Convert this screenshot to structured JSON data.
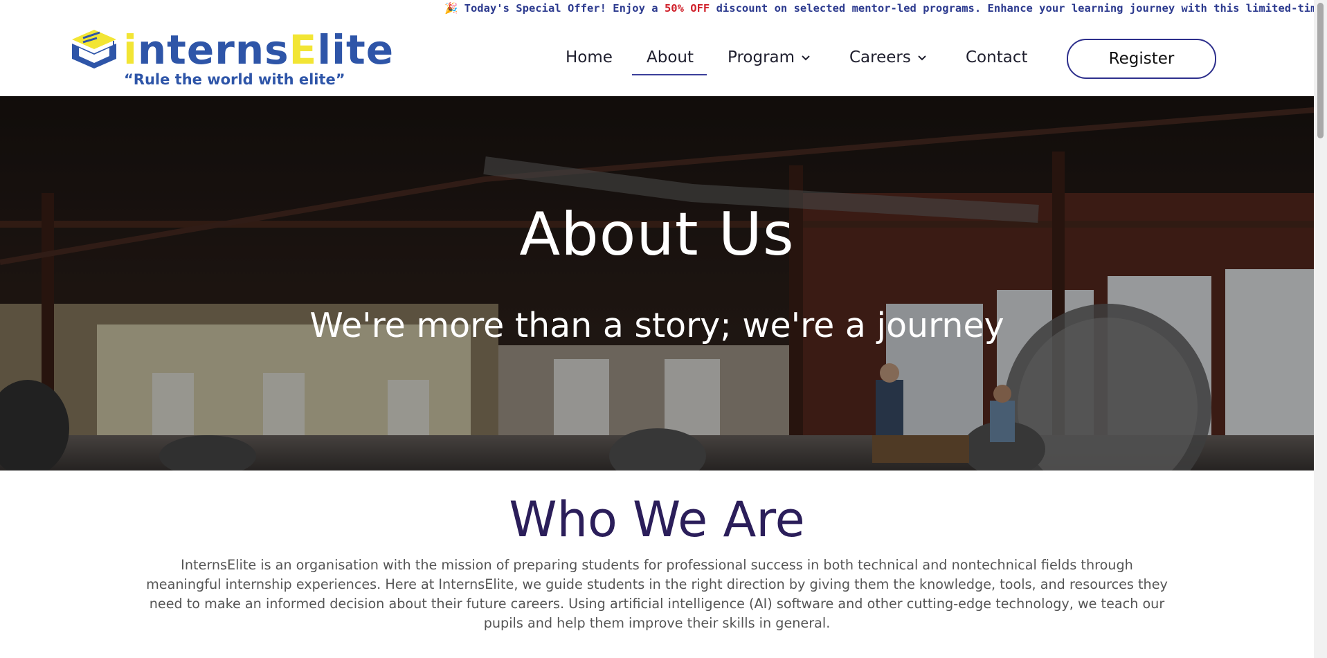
{
  "announcement": {
    "icon_left": "party-popper-icon",
    "prefix": "Today's Special Offer! Enjoy a ",
    "highlight": "50% OFF",
    "suffix": " discount on selected mentor-led programs. Enhance your learning journey with this limited-time offer!",
    "trailing_icons": [
      "sparkle-icon",
      "gift-icon"
    ],
    "highlight_color": "#d0202a",
    "text_color": "#2d3b8f"
  },
  "logo": {
    "word_part1": "i",
    "word_part2": "nterns",
    "word_part3": "E",
    "word_part4": "lite",
    "tagline": "“Rule the world with elite”",
    "primary_color": "#2e55a8",
    "accent_color": "#f2e534"
  },
  "nav": {
    "home": "Home",
    "about": "About",
    "program": "Program",
    "careers": "Careers",
    "contact": "Contact",
    "register": "Register",
    "active": "About"
  },
  "hero": {
    "title": "About Us",
    "subtitle": "We're more than a story; we're a journey"
  },
  "who": {
    "title": "Who We Are",
    "body": "InternsElite is an organisation with the mission of preparing students for professional success in both technical and nontechnical fields through meaningful internship experiences. Here at InternsElite, we guide students in the right direction by giving them the knowledge, tools, and resources they need to make an informed decision about their future careers. Using artificial intelligence (AI) software and other cutting-edge technology, we teach our pupils and help them improve their skills in general."
  },
  "colors": {
    "heading": "#2b1e5a",
    "nav_accent": "#3b3f9a"
  }
}
